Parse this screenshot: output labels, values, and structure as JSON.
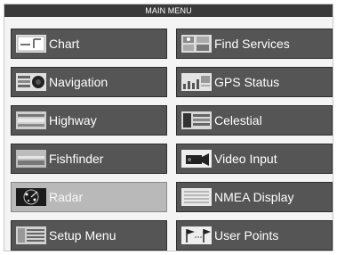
{
  "menu": {
    "title": "MAIN MENU",
    "items": [
      {
        "label": "Chart",
        "icon": "chart-icon"
      },
      {
        "label": "Find Services",
        "icon": "find-services-icon"
      },
      {
        "label": "Navigation",
        "icon": "navigation-icon"
      },
      {
        "label": "GPS Status",
        "icon": "gps-status-icon"
      },
      {
        "label": "Highway",
        "icon": "highway-icon"
      },
      {
        "label": "Celestial",
        "icon": "celestial-icon"
      },
      {
        "label": "Fishfinder",
        "icon": "fishfinder-icon"
      },
      {
        "label": "Video Input",
        "icon": "video-camera-icon"
      },
      {
        "label": "Radar",
        "icon": "radar-icon",
        "selected": true
      },
      {
        "label": "NMEA Display",
        "icon": "nmea-display-icon"
      },
      {
        "label": "Setup Menu",
        "icon": "setup-menu-icon"
      },
      {
        "label": "User Points",
        "icon": "user-points-flags-icon"
      }
    ]
  },
  "colors": {
    "button_bg": "#555555",
    "selected_bg": "#b9b9b9",
    "titlebar_bg": "#3a3a3a",
    "panel_bg": "#f4f4f4"
  }
}
